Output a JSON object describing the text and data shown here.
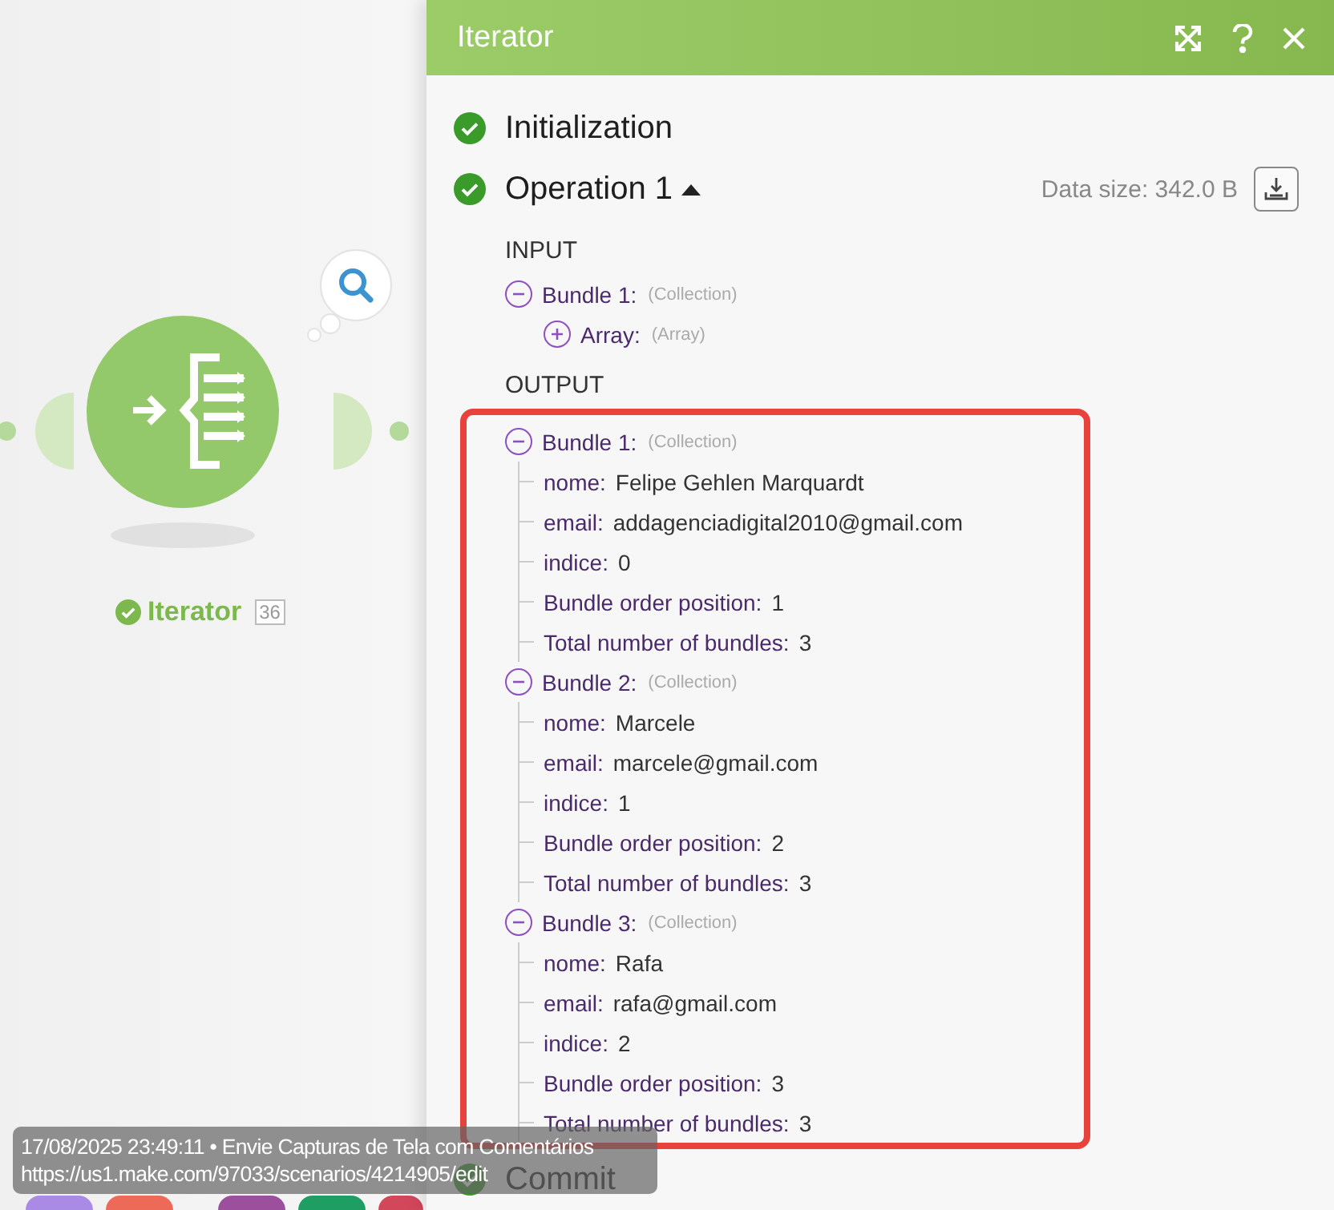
{
  "canvas": {
    "module": {
      "label": "Iterator",
      "count": "36",
      "status_ok": true
    },
    "dock": [
      {
        "color": "#a98be6"
      },
      {
        "color": "#ee6a58"
      },
      {
        "color": "#9b4f9c"
      },
      {
        "color": "#1f9e64"
      },
      {
        "color": "#d3475b"
      }
    ]
  },
  "panel": {
    "title": "Iterator",
    "steps": [
      {
        "kind": "plain",
        "label": "Initialization"
      },
      {
        "kind": "operation",
        "label": "Operation 1",
        "expanded": true,
        "data_size": "Data size: 342.0 B",
        "input": {
          "title": "INPUT",
          "items": [
            {
              "kind": "collection",
              "label": "Bundle 1:",
              "type": "(Collection)",
              "expanded": true,
              "children": [
                {
                  "kind": "collection",
                  "label": "Array:",
                  "type": "(Array)",
                  "expanded": false
                }
              ]
            }
          ]
        },
        "output": {
          "title": "OUTPUT",
          "items": [
            {
              "kind": "collection",
              "label": "Bundle 1:",
              "type": "(Collection)",
              "expanded": true,
              "children": [
                {
                  "kind": "field",
                  "label": "nome:",
                  "value": "Felipe Gehlen Marquardt"
                },
                {
                  "kind": "field",
                  "label": "email:",
                  "value": "addagenciadigital2010@gmail.com"
                },
                {
                  "kind": "field",
                  "label": "indice:",
                  "value": "0"
                },
                {
                  "kind": "field",
                  "label": "Bundle order position:",
                  "value": "1"
                },
                {
                  "kind": "field",
                  "label": "Total number of bundles:",
                  "value": "3"
                }
              ]
            },
            {
              "kind": "collection",
              "label": "Bundle 2:",
              "type": "(Collection)",
              "expanded": true,
              "children": [
                {
                  "kind": "field",
                  "label": "nome:",
                  "value": "Marcele"
                },
                {
                  "kind": "field",
                  "label": "email:",
                  "value": "marcele@gmail.com"
                },
                {
                  "kind": "field",
                  "label": "indice:",
                  "value": "1"
                },
                {
                  "kind": "field",
                  "label": "Bundle order position:",
                  "value": "2"
                },
                {
                  "kind": "field",
                  "label": "Total number of bundles:",
                  "value": "3"
                }
              ]
            },
            {
              "kind": "collection",
              "label": "Bundle 3:",
              "type": "(Collection)",
              "expanded": true,
              "children": [
                {
                  "kind": "field",
                  "label": "nome:",
                  "value": "Rafa"
                },
                {
                  "kind": "field",
                  "label": "email:",
                  "value": "rafa@gmail.com"
                },
                {
                  "kind": "field",
                  "label": "indice:",
                  "value": "2"
                },
                {
                  "kind": "field",
                  "label": "Bundle order position:",
                  "value": "3"
                },
                {
                  "kind": "field",
                  "label": "Total number of bundles:",
                  "value": "3"
                }
              ]
            }
          ]
        }
      },
      {
        "kind": "plain",
        "label": "Commit"
      }
    ]
  },
  "tooltip": {
    "line_1": "17/08/2025 23:49:11 • Envie Capturas de Tela com Comentários",
    "line_2": "https://us1.make.com/97033/scenarios/4214905/edit"
  }
}
